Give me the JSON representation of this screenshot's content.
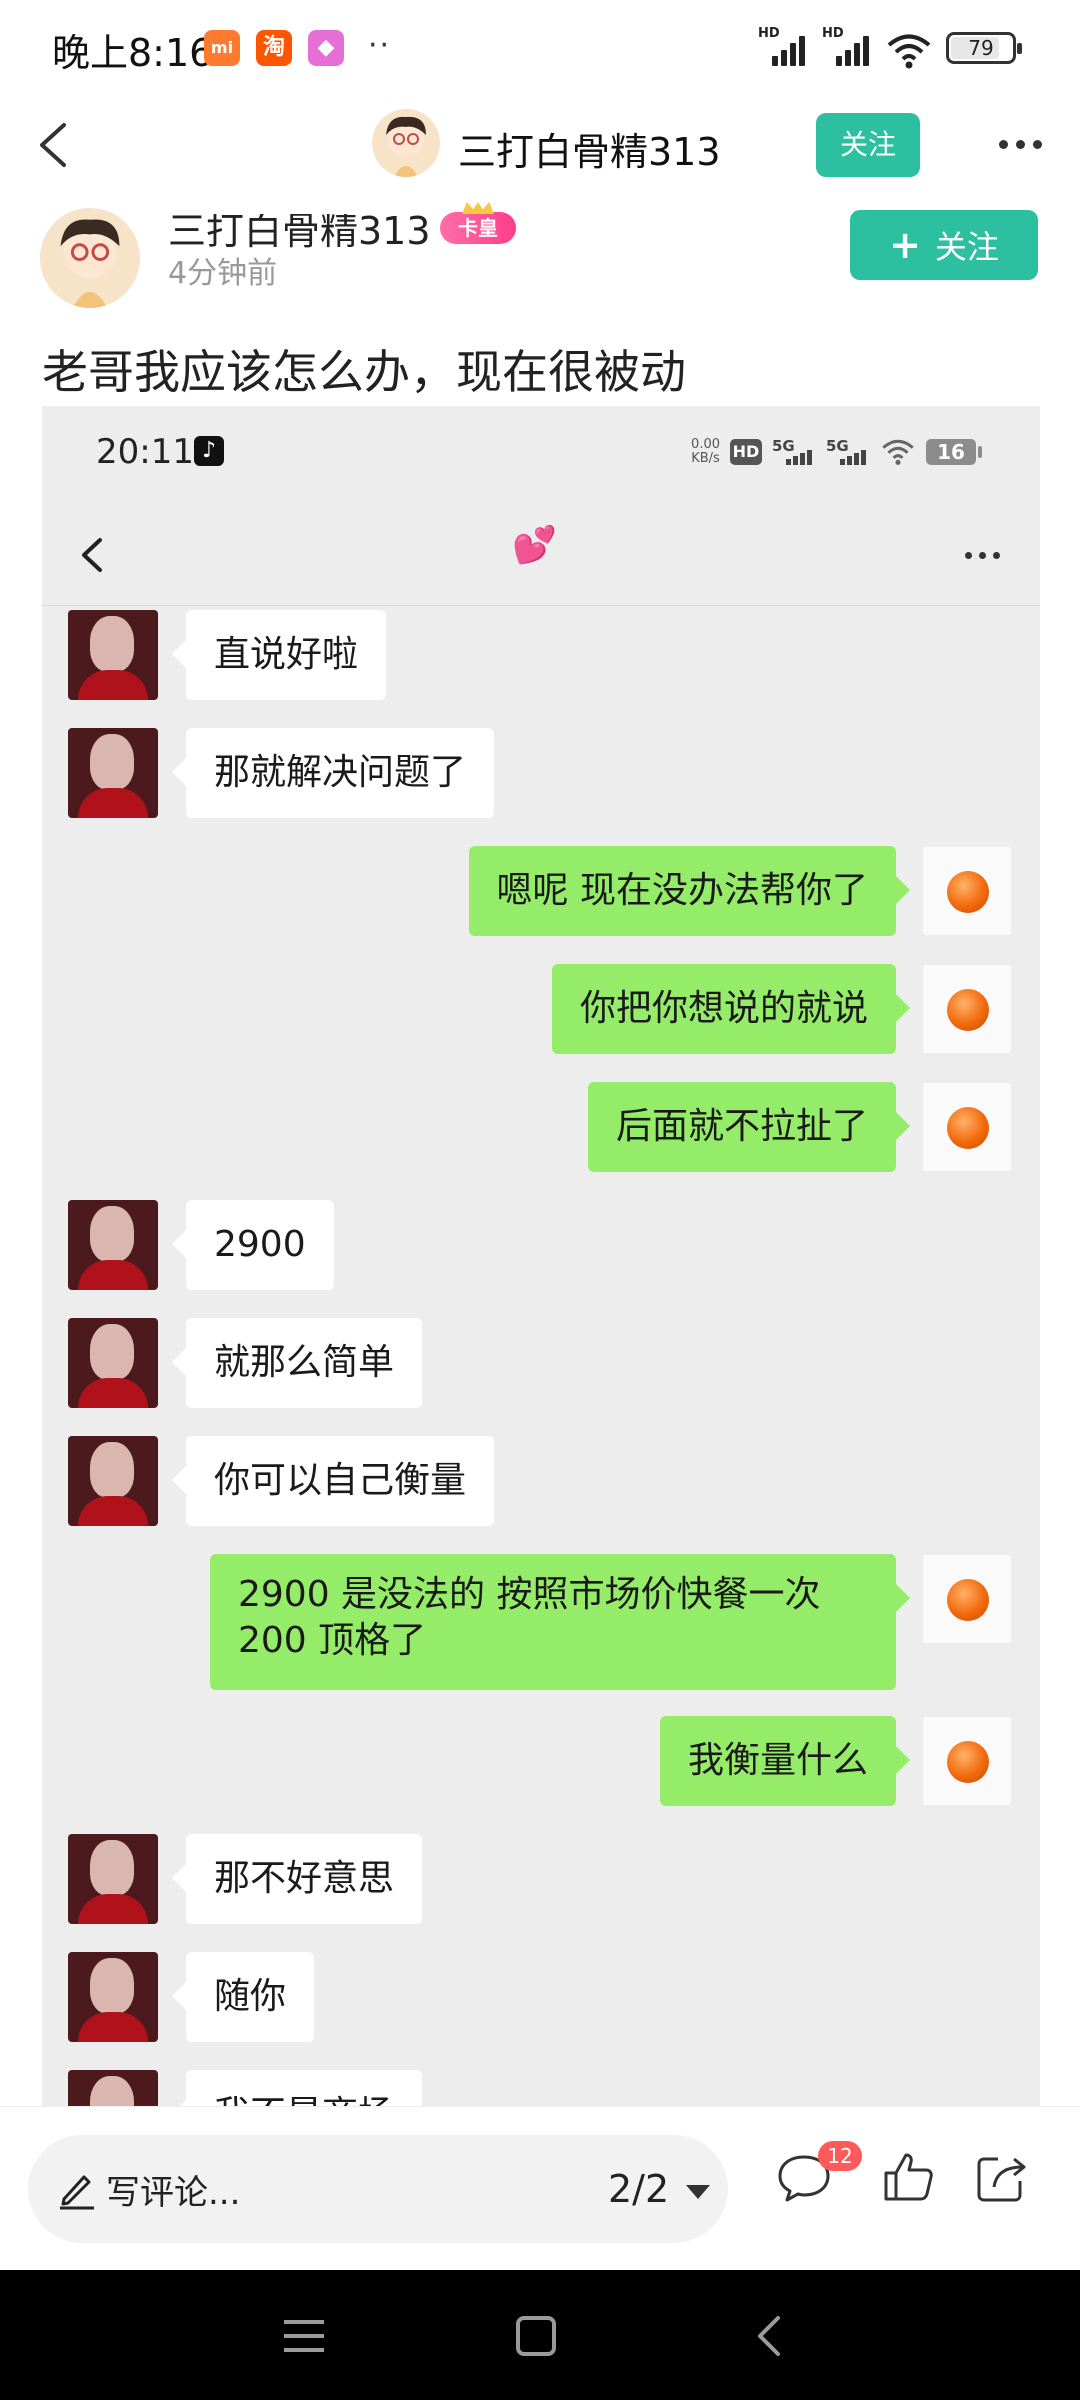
{
  "status_bar": {
    "time": "晚上8:16",
    "apps": [
      {
        "name": "mi-app-icon",
        "glyph": "mi",
        "color": "#ff7a2f"
      },
      {
        "name": "taobao-app-icon",
        "glyph": "淘",
        "color": "#ff5500"
      },
      {
        "name": "game-app-icon",
        "glyph": "◆",
        "color": "#e66fd7"
      }
    ],
    "more_dots": "··",
    "battery": "79",
    "hd_label": "HD"
  },
  "header": {
    "username": "三打白骨精313",
    "follow_label": "关注"
  },
  "post": {
    "author": "三打白骨精313",
    "badge": "卡皇",
    "time_ago": "4分钟前",
    "follow_label": "关注",
    "follow_plus": "+",
    "title": "老哥我应该怎么办，现在很被动"
  },
  "embedded": {
    "time": "20:11",
    "tiktok_glyph": "♪",
    "speed": [
      "0.00",
      "KB/s"
    ],
    "hd_label": "HD",
    "net_label": "5G",
    "battery": "16",
    "chat_title": "💕",
    "messages": [
      {
        "side": "left",
        "text": "直说好啦"
      },
      {
        "side": "left",
        "text": "那就解决问题了"
      },
      {
        "side": "right",
        "text": "嗯呢 现在没办法帮你了"
      },
      {
        "side": "right",
        "text": "你把你想说的就说"
      },
      {
        "side": "right",
        "text": "后面就不拉扯了"
      },
      {
        "side": "left",
        "text": "2900"
      },
      {
        "side": "left",
        "text": "就那么简单"
      },
      {
        "side": "left",
        "text": "你可以自己衡量"
      },
      {
        "side": "right",
        "text": "2900 是没法的 按照市场价快餐一次 200 顶格了"
      },
      {
        "side": "right",
        "text": "我衡量什么"
      },
      {
        "side": "left",
        "text": "那不好意思"
      },
      {
        "side": "left",
        "text": "随你"
      },
      {
        "side": "left",
        "text": "我不是商场"
      }
    ]
  },
  "bottom_bar": {
    "comment_placeholder": "写评论...",
    "pager": "2/2",
    "comment_count": "12"
  },
  "colors": {
    "accent": "#2dc0a0",
    "bubble_green": "#95ec69",
    "badge_red": "#ff5a5a"
  }
}
